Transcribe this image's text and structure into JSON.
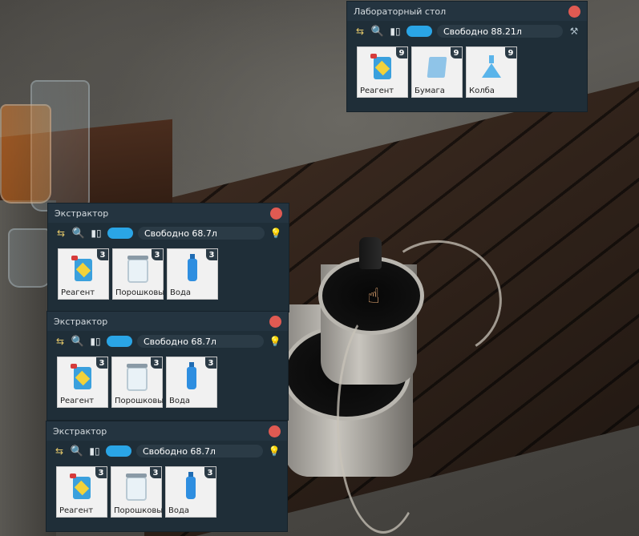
{
  "lab_table": {
    "title": "Лабораторный стол",
    "capacity": "Свободно 88.21л",
    "items": [
      {
        "label": "Реагент",
        "count": "9",
        "icon": "reagent-canister-icon"
      },
      {
        "label": "Бумага",
        "count": "9",
        "icon": "paper-icon"
      },
      {
        "label": "Колба",
        "count": "9",
        "icon": "flask-icon"
      }
    ]
  },
  "extractors": [
    {
      "title": "Экстрактор",
      "capacity": "Свободно 68.7л",
      "items": [
        {
          "label": "Реагент",
          "count": "3",
          "icon": "reagent-canister-icon"
        },
        {
          "label": "Порошковы",
          "count": "3",
          "icon": "powder-jar-icon"
        },
        {
          "label": "Вода",
          "count": "3",
          "icon": "water-bottle-icon"
        }
      ]
    },
    {
      "title": "Экстрактор",
      "capacity": "Свободно 68.7л",
      "items": [
        {
          "label": "Реагент",
          "count": "3",
          "icon": "reagent-canister-icon"
        },
        {
          "label": "Порошковы",
          "count": "3",
          "icon": "powder-jar-icon"
        },
        {
          "label": "Вода",
          "count": "3",
          "icon": "water-bottle-icon"
        }
      ]
    },
    {
      "title": "Экстрактор",
      "capacity": "Свободно 68.7л",
      "items": [
        {
          "label": "Реагент",
          "count": "3",
          "icon": "reagent-canister-icon"
        },
        {
          "label": "Порошковы",
          "count": "3",
          "icon": "powder-jar-icon"
        },
        {
          "label": "Вода",
          "count": "3",
          "icon": "water-bottle-icon"
        }
      ]
    }
  ],
  "colors": {
    "panel_bg": "#1f2e38",
    "close_button": "#e05a52",
    "toggle_accent": "#2aa5e6"
  }
}
